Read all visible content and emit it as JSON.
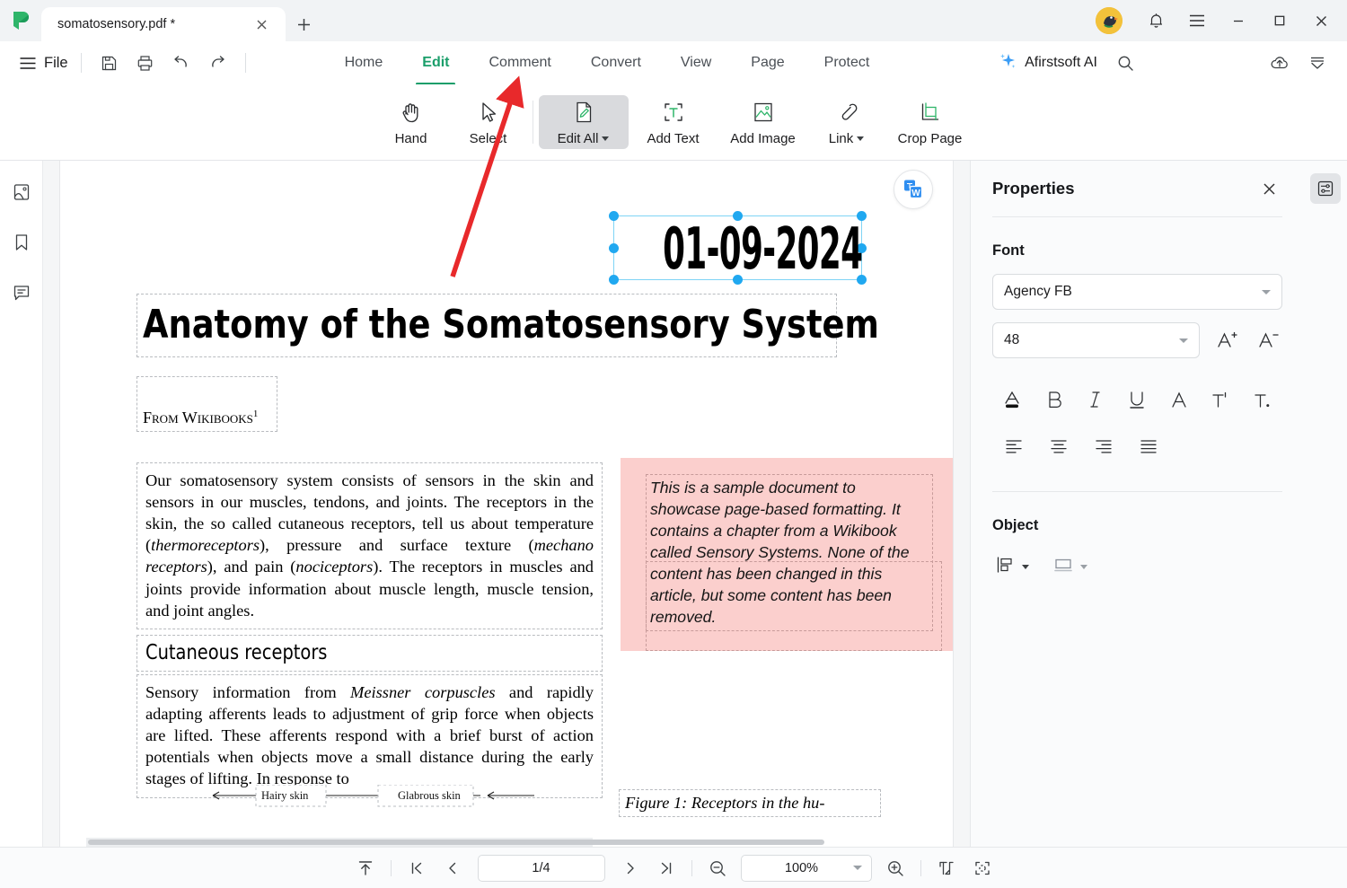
{
  "titlebar": {
    "tab_title": "somatosensory.pdf *",
    "close_tab_label": "×",
    "new_tab_label": "+",
    "logo_name": "afirstsoft-logo"
  },
  "menubar": {
    "file_label": "File",
    "quick_actions": [
      "save-icon",
      "print-icon",
      "undo-icon",
      "redo-icon"
    ],
    "tabs": [
      {
        "label": "Home",
        "active": false
      },
      {
        "label": "Edit",
        "active": true
      },
      {
        "label": "Comment",
        "active": false
      },
      {
        "label": "Convert",
        "active": false
      },
      {
        "label": "View",
        "active": false
      },
      {
        "label": "Page",
        "active": false
      },
      {
        "label": "Protect",
        "active": false
      }
    ],
    "ai_label": "Afirstsoft AI",
    "accent_color": "#1a9e6a"
  },
  "ribbon": {
    "items": [
      {
        "label": "Hand",
        "icon": "hand-icon",
        "selected": false,
        "caret": false
      },
      {
        "label": "Select",
        "icon": "cursor-arrow-icon",
        "selected": false,
        "caret": false
      },
      {
        "label": "Edit All",
        "icon": "edit-document-icon",
        "selected": true,
        "caret": true
      },
      {
        "label": "Add Text",
        "icon": "add-text-icon",
        "selected": false,
        "caret": false
      },
      {
        "label": "Add Image",
        "icon": "add-image-icon",
        "selected": false,
        "caret": false
      },
      {
        "label": "Link",
        "icon": "link-icon",
        "selected": false,
        "caret": true
      },
      {
        "label": "Crop Page",
        "icon": "crop-page-icon",
        "selected": false,
        "caret": false
      }
    ]
  },
  "left_rail": [
    {
      "name": "thumbnails-icon"
    },
    {
      "name": "bookmarks-icon"
    },
    {
      "name": "comments-icon"
    }
  ],
  "document": {
    "date_text": "01-09-2024",
    "title": "Anatomy of the Somatosensory System",
    "from_line": "From Wikibooks",
    "from_superscript": "1",
    "paragraph_1": "Our somatosensory system consists of sensors in the skin and sensors in our muscles, tendons, and joints. The receptors in the skin, the so called cutaneous receptors, tell us about temperature (thermoreceptors), pressure and surface texture (mechano receptors), and pain (nociceptors). The receptors in muscles and joints provide information about muscle length, muscle tension, and joint angles.",
    "pink_note": "This is a sample document to showcase page-based formatting. It contains a chapter from a Wikibook called Sensory Systems. None of the content has been changed in this article, but some content has been removed.",
    "section_heading": "Cutaneous receptors",
    "paragraph_2": "Sensory information from Meissner corpuscles and rapidly adapting afferents leads to adjustment of grip force when objects are lifted. These afferents respond with a brief burst of action potentials when objects move a small distance during the early stages of lifting. In response to",
    "figure_label_1": "Hairy skin",
    "figure_label_2": "Glabrous skin",
    "figure_caption": "Figure 1:  Receptors in the hu-",
    "translate_button": "translate-to-word-icon"
  },
  "properties": {
    "title": "Properties",
    "close_label": "×",
    "font_section": "Font",
    "font_family_value": "Agency FB",
    "font_size_value": "48",
    "increase_font": "increase-font-size-icon",
    "decrease_font": "decrease-font-size-icon",
    "format_buttons": [
      "font-color-icon",
      "bold-icon",
      "italic-icon",
      "underline-icon",
      "strikethrough-icon",
      "superscript-icon",
      "subscript-icon"
    ],
    "align_buttons": [
      "align-left-icon",
      "align-center-icon",
      "align-right-icon",
      "align-justify-icon"
    ],
    "object_section": "Object",
    "object_buttons": [
      "align-objects-icon",
      "arrange-objects-icon"
    ],
    "panel_toggle": "properties-panel-toggle-icon"
  },
  "bottombar": {
    "scroll_top_icon": "scroll-to-top-icon",
    "first_page_icon": "first-page-icon",
    "prev_page_icon": "previous-page-icon",
    "page_value": "1/4",
    "next_page_icon": "next-page-icon",
    "last_page_icon": "last-page-icon",
    "zoom_out_icon": "zoom-out-icon",
    "zoom_value": "100%",
    "zoom_in_icon": "zoom-in-icon",
    "fit_page_icon": "fit-page-icon",
    "fullscreen_icon": "fullscreen-icon"
  }
}
